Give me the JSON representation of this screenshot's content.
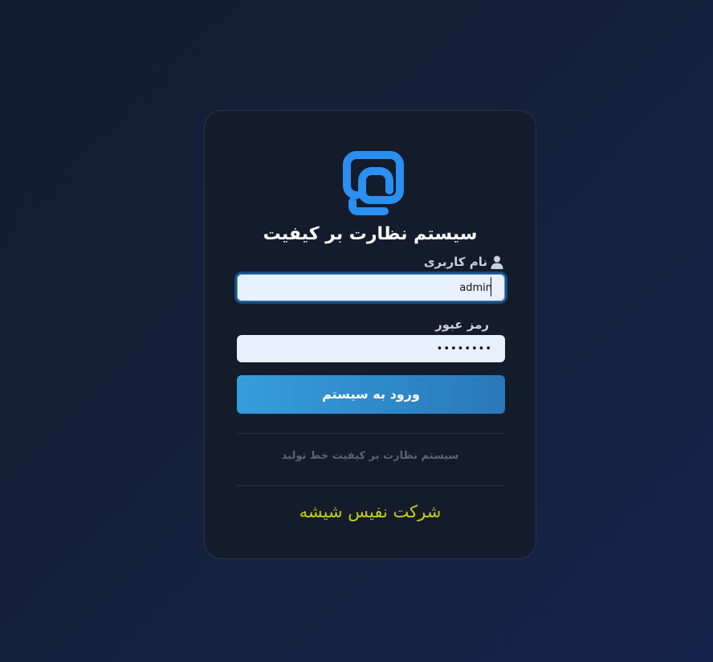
{
  "login": {
    "title": "سیستم نظارت بر کیفیت",
    "username_label": "نام کاربری",
    "username_value": "admin",
    "password_label": "رمز عبور",
    "password_value": "••••••••",
    "submit_label": "ورود به سیستم",
    "subtitle": "سیستم نظارت بر کیفیت خط تولید",
    "company": "شرکت نفیس شیشه"
  },
  "colors": {
    "background": "#131d33",
    "card": "#141c2c",
    "accent": "#2f8bcb",
    "logo": "#2a8ff0",
    "company_text": "#c8cf13"
  },
  "icons": {
    "logo": "brand-logo-icon",
    "username": "user-icon"
  }
}
